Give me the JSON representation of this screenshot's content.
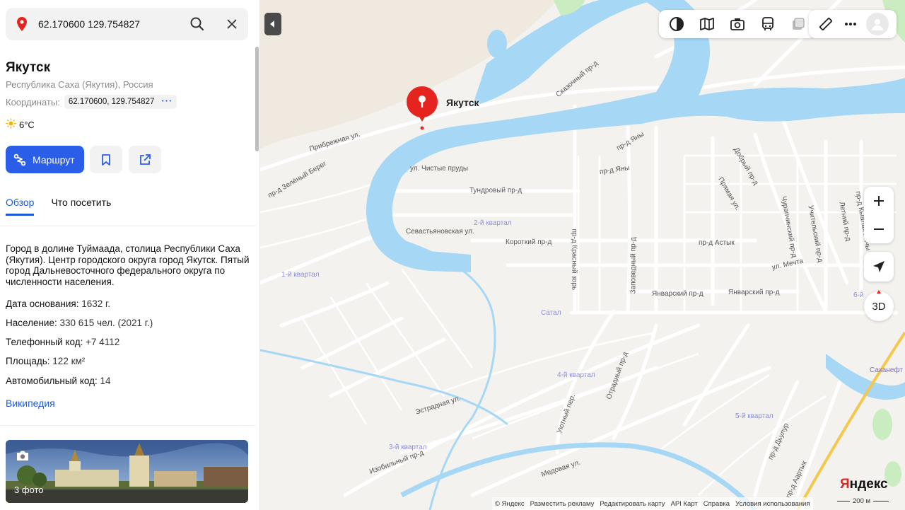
{
  "search": {
    "value": "62.170600 129.754827"
  },
  "place": {
    "title": "Якутск",
    "subtitle": "Республика Саха (Якутия), Россия",
    "coords_label": "Координаты:",
    "coords_value": "62.170600, 129.754827",
    "temperature": "6°C"
  },
  "actions": {
    "route_label": "Маршрут"
  },
  "tabs": [
    {
      "label": "Обзор",
      "active": true
    },
    {
      "label": "Что посетить",
      "active": false
    }
  ],
  "description": "Город в долине Туймаада, столица Республики Саха (Якутия). Центр городского округа город Якутск. Пятый город Дальневосточного федерального округа по численности населения.",
  "facts": [
    {
      "key": "Дата основания:",
      "value": "1632 г."
    },
    {
      "key": "Население:",
      "value": "330 615 чел. (2021 г.)"
    },
    {
      "key": "Телефонный код:",
      "value": "+7 4112"
    },
    {
      "key": "Площадь:",
      "value": "122 км²"
    },
    {
      "key": "Автомобильный код:",
      "value": "14"
    }
  ],
  "wiki_link": "Википедия",
  "photos": {
    "count_label": "3 фото"
  },
  "map": {
    "marker_label": "Якутск",
    "labels": {
      "skazochny": "Сказочный пр-д",
      "pribrezhnaya": "Прибрежная ул.",
      "zeleny_bereg": "пр-д Зелёный Берег",
      "chistye_prudy": "ул. Чистые пруды",
      "tundrovy": "Тундровый пр-д",
      "kvartal2": "2-й квартал",
      "sevastyanovskaya": "Севастьяновская ул.",
      "korotky": "Короткий пр-д",
      "krasny_zor": "пр-д Красный зорь",
      "zapovedny": "Заповедный пр-д",
      "astyk": "пр-д Астык",
      "kvartal1": "1-й квартал",
      "satal": "Сатал",
      "yanvarsky1": "Январский пр-д",
      "yanvarsky2": "Январский пр-д",
      "mechta": "ул. Мечта",
      "yany1": "пр-д Яны",
      "yany2": "пр-д Яны",
      "dobry": "Добрый пр-д",
      "pryamaya": "Прямая ул.",
      "churapchinsky": "Чурапчинский пр-д",
      "uchitelsky": "Учительский пр-д",
      "letny": "Летний пр-д",
      "kyalyakh": "пр-д Кыалах Аччы",
      "kvartal4": "4-й квартал",
      "otradny": "Отрадный пр-д",
      "estradnaya": "Эстрадная ул.",
      "uyutny": "Уютный пер.",
      "kvartal3": "3-й квартал",
      "izobilny": "Изобильный пр-д",
      "medovaya": "Медовая ул.",
      "kvartal5": "5-й квартал",
      "dyulur": "пр-д Дьулур",
      "aartyk": "пр-д Аартык",
      "kvartal6": "6-й",
      "sakhaneft": "Саханефт"
    },
    "btn_3d": "3D",
    "footer": [
      "© Яндекс",
      "Разместить рекламу",
      "Редактировать карту",
      "API Карт",
      "Справка",
      "Условия использования"
    ],
    "scale": "200 м",
    "logo_y": "Я",
    "logo_rest": "ндекс"
  },
  "colors": {
    "accent": "#2b5ee8",
    "marker": "#e6241f",
    "water": "#a6d8f5"
  }
}
